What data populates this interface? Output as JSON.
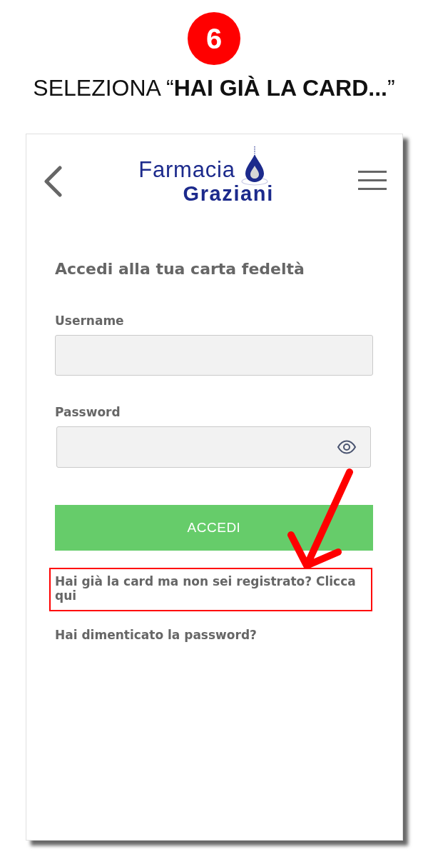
{
  "step": {
    "number": "6",
    "title": "SELEZIONA “**HAI GIÀ LA CARD...**”"
  },
  "screen": {
    "header": {
      "logo": {
        "line_1": "Farmacia",
        "line_2": "Graziani"
      }
    },
    "form": {
      "title": "Accedi alla tua carta fedeltà",
      "fields": [
        {
          "label": "Username",
          "kind": "text"
        },
        {
          "label": "Password",
          "kind": "password"
        }
      ],
      "submit": "ACCEDI",
      "links": [
        {
          "text": "Hai già la card ma non sei registrato? Clicca qui",
          "highlighted": true
        },
        {
          "text": "Hai dimenticato la password?",
          "highlighted": false
        }
      ]
    }
  }
}
